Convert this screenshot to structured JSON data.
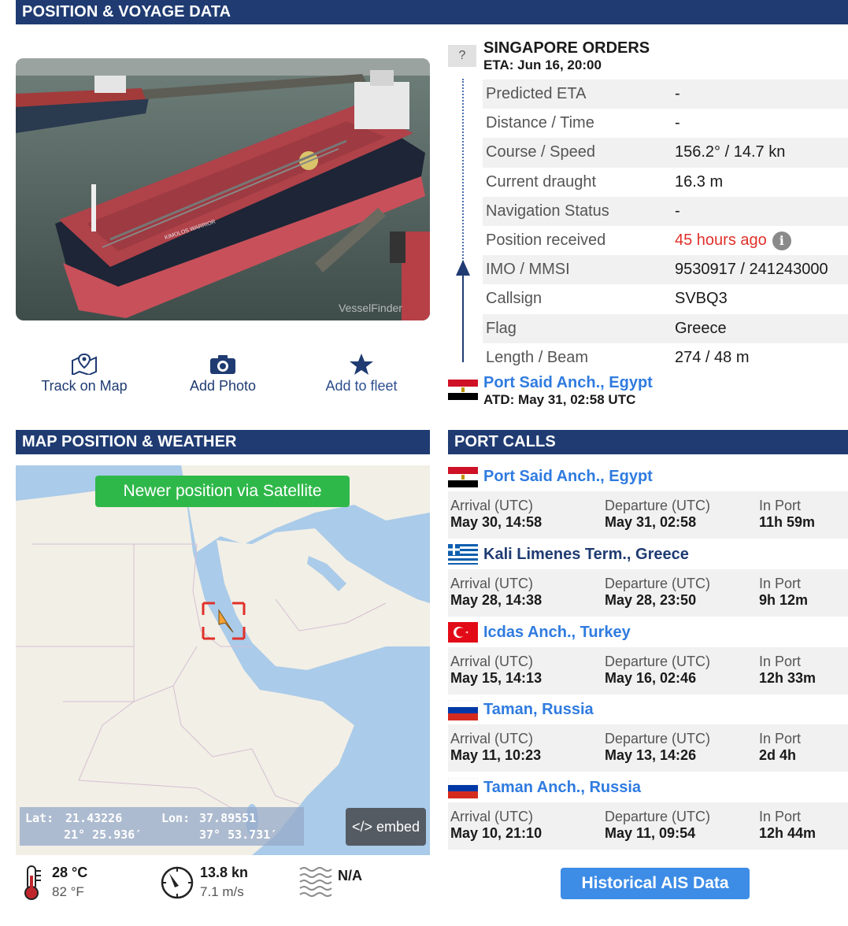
{
  "headers": {
    "position": "POSITION & VOYAGE DATA",
    "map": "MAP POSITION & WEATHER",
    "portcalls": "PORT CALLS"
  },
  "photo": {
    "watermark": "VesselFinder",
    "hull_name": "KIMOLOS WARRIOR"
  },
  "actions": {
    "track": "Track on Map",
    "photo": "Add Photo",
    "fleet": "Add to fleet"
  },
  "voyage": {
    "unknown_mark": "?",
    "destination": "SINGAPORE ORDERS",
    "eta": "ETA: Jun 16, 20:00",
    "rows": [
      {
        "label": "Predicted ETA",
        "value": "-"
      },
      {
        "label": "Distance / Time",
        "value": "-"
      },
      {
        "label": "Course / Speed",
        "value": "156.2° / 14.7 kn"
      },
      {
        "label": "Current draught",
        "value": "16.3 m"
      },
      {
        "label": "Navigation Status",
        "value": "-"
      },
      {
        "label": "Position received",
        "value": "45 hours ago"
      },
      {
        "label": "IMO / MMSI",
        "value": "9530917 / 241243000"
      },
      {
        "label": "Callsign",
        "value": "SVBQ3"
      },
      {
        "label": "Flag",
        "value": "Greece"
      },
      {
        "label": "Length / Beam",
        "value": "274 / 48 m"
      }
    ],
    "info_icon": "i",
    "departure_port": "Port Said Anch., Egypt",
    "atd": "ATD: May 31, 02:58 UTC"
  },
  "map": {
    "satellite_button": "Newer position via Satellite",
    "lat_label": "Lat:",
    "lat": "21.43226",
    "lat_dms": "21° 25.936′",
    "lon_label": "Lon:",
    "lon": "37.89551",
    "lon_dms": "37° 53.731′",
    "embed": "</> embed"
  },
  "weather": {
    "temp_c": "28 °C",
    "temp_f": "82 °F",
    "wind_kn": "13.8 kn",
    "wind_ms": "7.1 m/s",
    "waves": "N/A"
  },
  "portcalls": {
    "labels": {
      "arrival": "Arrival (UTC)",
      "departure": "Departure (UTC)",
      "inport": "In Port"
    },
    "items": [
      {
        "port": "Port Said Anch., Egypt",
        "flag": "egypt",
        "arrival": "May 30, 14:58",
        "departure": "May 31, 02:58",
        "inport": "11h 59m"
      },
      {
        "port": "Kali Limenes Term., Greece",
        "flag": "greece",
        "arrival": "May 28, 14:38",
        "departure": "May 28, 23:50",
        "inport": "9h 12m"
      },
      {
        "port": "Icdas Anch., Turkey",
        "flag": "turkey",
        "arrival": "May 15, 14:13",
        "departure": "May 16, 02:46",
        "inport": "12h 33m"
      },
      {
        "port": "Taman, Russia",
        "flag": "russia",
        "arrival": "May 11, 10:23",
        "departure": "May 13, 14:26",
        "inport": "2d 4h"
      },
      {
        "port": "Taman Anch., Russia",
        "flag": "russia",
        "arrival": "May 10, 21:10",
        "departure": "May 11, 09:54",
        "inport": "12h 44m"
      }
    ],
    "history_button": "Historical AIS Data"
  },
  "colors": {
    "header": "#1f3b72",
    "link": "#2f7be0",
    "alert": "#e0302a",
    "sat_button": "#2fb84a",
    "history_button": "#3d8ce6"
  }
}
